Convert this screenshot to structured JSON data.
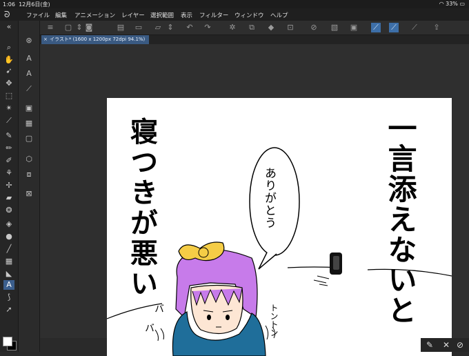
{
  "status": {
    "time": "1:06",
    "date": "12月6日(金)",
    "battery": "33%"
  },
  "menu": [
    "ファイル",
    "編集",
    "アニメーション",
    "レイヤー",
    "選択範囲",
    "表示",
    "フィルター",
    "ウィンドウ",
    "ヘルプ"
  ],
  "tab": {
    "title": "イラスト* (1600 x 1200px 72dpi 94.1%)",
    "close": "×"
  },
  "artwork": {
    "title_right": "一言添えないと",
    "title_left": "寝つきが悪い",
    "speech": "ありがとう",
    "sfx_left_1": "バ",
    "sfx_left_2": "バ",
    "sfx_right": "トントン"
  },
  "icons": {
    "logo": "clip-studio-logo-icon",
    "pen": "pen-icon",
    "close": "close-icon",
    "confirm": "check-circle-icon"
  }
}
